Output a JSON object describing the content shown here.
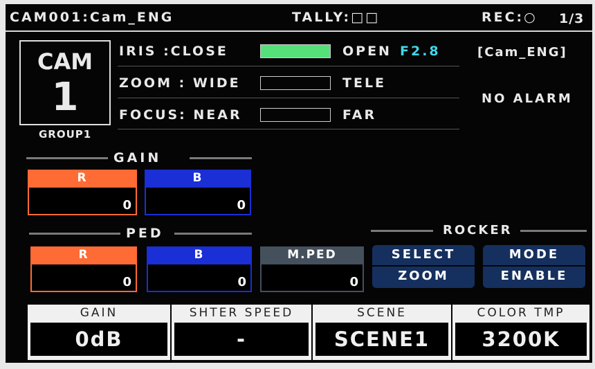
{
  "header": {
    "title": "CAM001:Cam_ENG",
    "tally": "TALLY:□□",
    "rec": "REC:○",
    "page": "1/3"
  },
  "camera": {
    "label": "CAM",
    "number": "1",
    "group": "GROUP1",
    "name": "[Cam_ENG]",
    "alarm": "NO ALARM"
  },
  "lens": {
    "iris": {
      "label": "IRIS :CLOSE",
      "end": "OPEN",
      "value": "F2.8",
      "level": 1.0
    },
    "zoom": {
      "label": "ZOOM : WIDE",
      "end": "TELE",
      "level": 0.0
    },
    "focus": {
      "label": "FOCUS: NEAR",
      "end": "FAR",
      "level": 0.0
    }
  },
  "gain": {
    "title": "GAIN",
    "r_label": "R",
    "r_value": "0",
    "b_label": "B",
    "b_value": "0"
  },
  "ped": {
    "title": "PED",
    "r_label": "R",
    "r_value": "0",
    "b_label": "B",
    "b_value": "0",
    "m_label": "M.PED",
    "m_value": "0"
  },
  "rocker": {
    "title": "ROCKER",
    "select_label": "SELECT",
    "select_value": "ZOOM",
    "mode_label": "MODE",
    "mode_value": "ENABLE"
  },
  "status": {
    "gain_label": "GAIN",
    "gain_value": "0dB",
    "shutter_label": "SHTER SPEED",
    "shutter_value": "-",
    "scene_label": "SCENE",
    "scene_value": "SCENE1",
    "color_label": "COLOR TMP",
    "color_value": "3200K"
  },
  "colors": {
    "iris_fill": "#55e07a",
    "iris_value": "#3fd7e8",
    "red_channel": "#ff6b35",
    "blue_channel": "#1a2fd6",
    "rocker_button": "#15305e"
  }
}
